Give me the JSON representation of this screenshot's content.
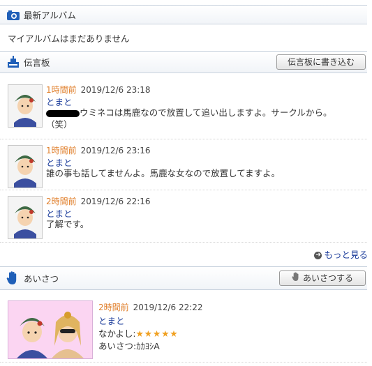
{
  "album": {
    "title": "最新アルバム",
    "empty_text": "マイアルバムはまだありません"
  },
  "board": {
    "title": "伝言板",
    "write_button": "伝言板に書き込む",
    "entries": [
      {
        "ago": "1時間前",
        "date": "2019/12/6 23:18",
        "name": "とまと",
        "line1": "ウミネコは馬鹿なので放置して追い出しますよ。サークルから。",
        "line2": "（笑）"
      },
      {
        "ago": "1時間前",
        "date": "2019/12/6 23:16",
        "name": "とまと",
        "line1": "誰の事も話してませんよ。馬鹿な女なので放置してますよ。"
      },
      {
        "ago": "2時間前",
        "date": "2019/12/6 22:16",
        "name": "とまと",
        "line1": "了解です。"
      }
    ],
    "more_label": "もっと見る"
  },
  "greeting": {
    "title": "あいさつ",
    "button": "あいさつする",
    "entry": {
      "ago": "2時間前",
      "date": "2019/12/6 22:22",
      "name": "とまと",
      "friendship_label": "なかよし:",
      "stars": "★★★★★",
      "greeting_text": "あいさつ:ｶｶﾖｼA"
    }
  },
  "colors": {
    "link": "#1a3b9a",
    "time": "#e07e29",
    "star": "#f0a020",
    "icon_blue": "#1f5fb8"
  }
}
